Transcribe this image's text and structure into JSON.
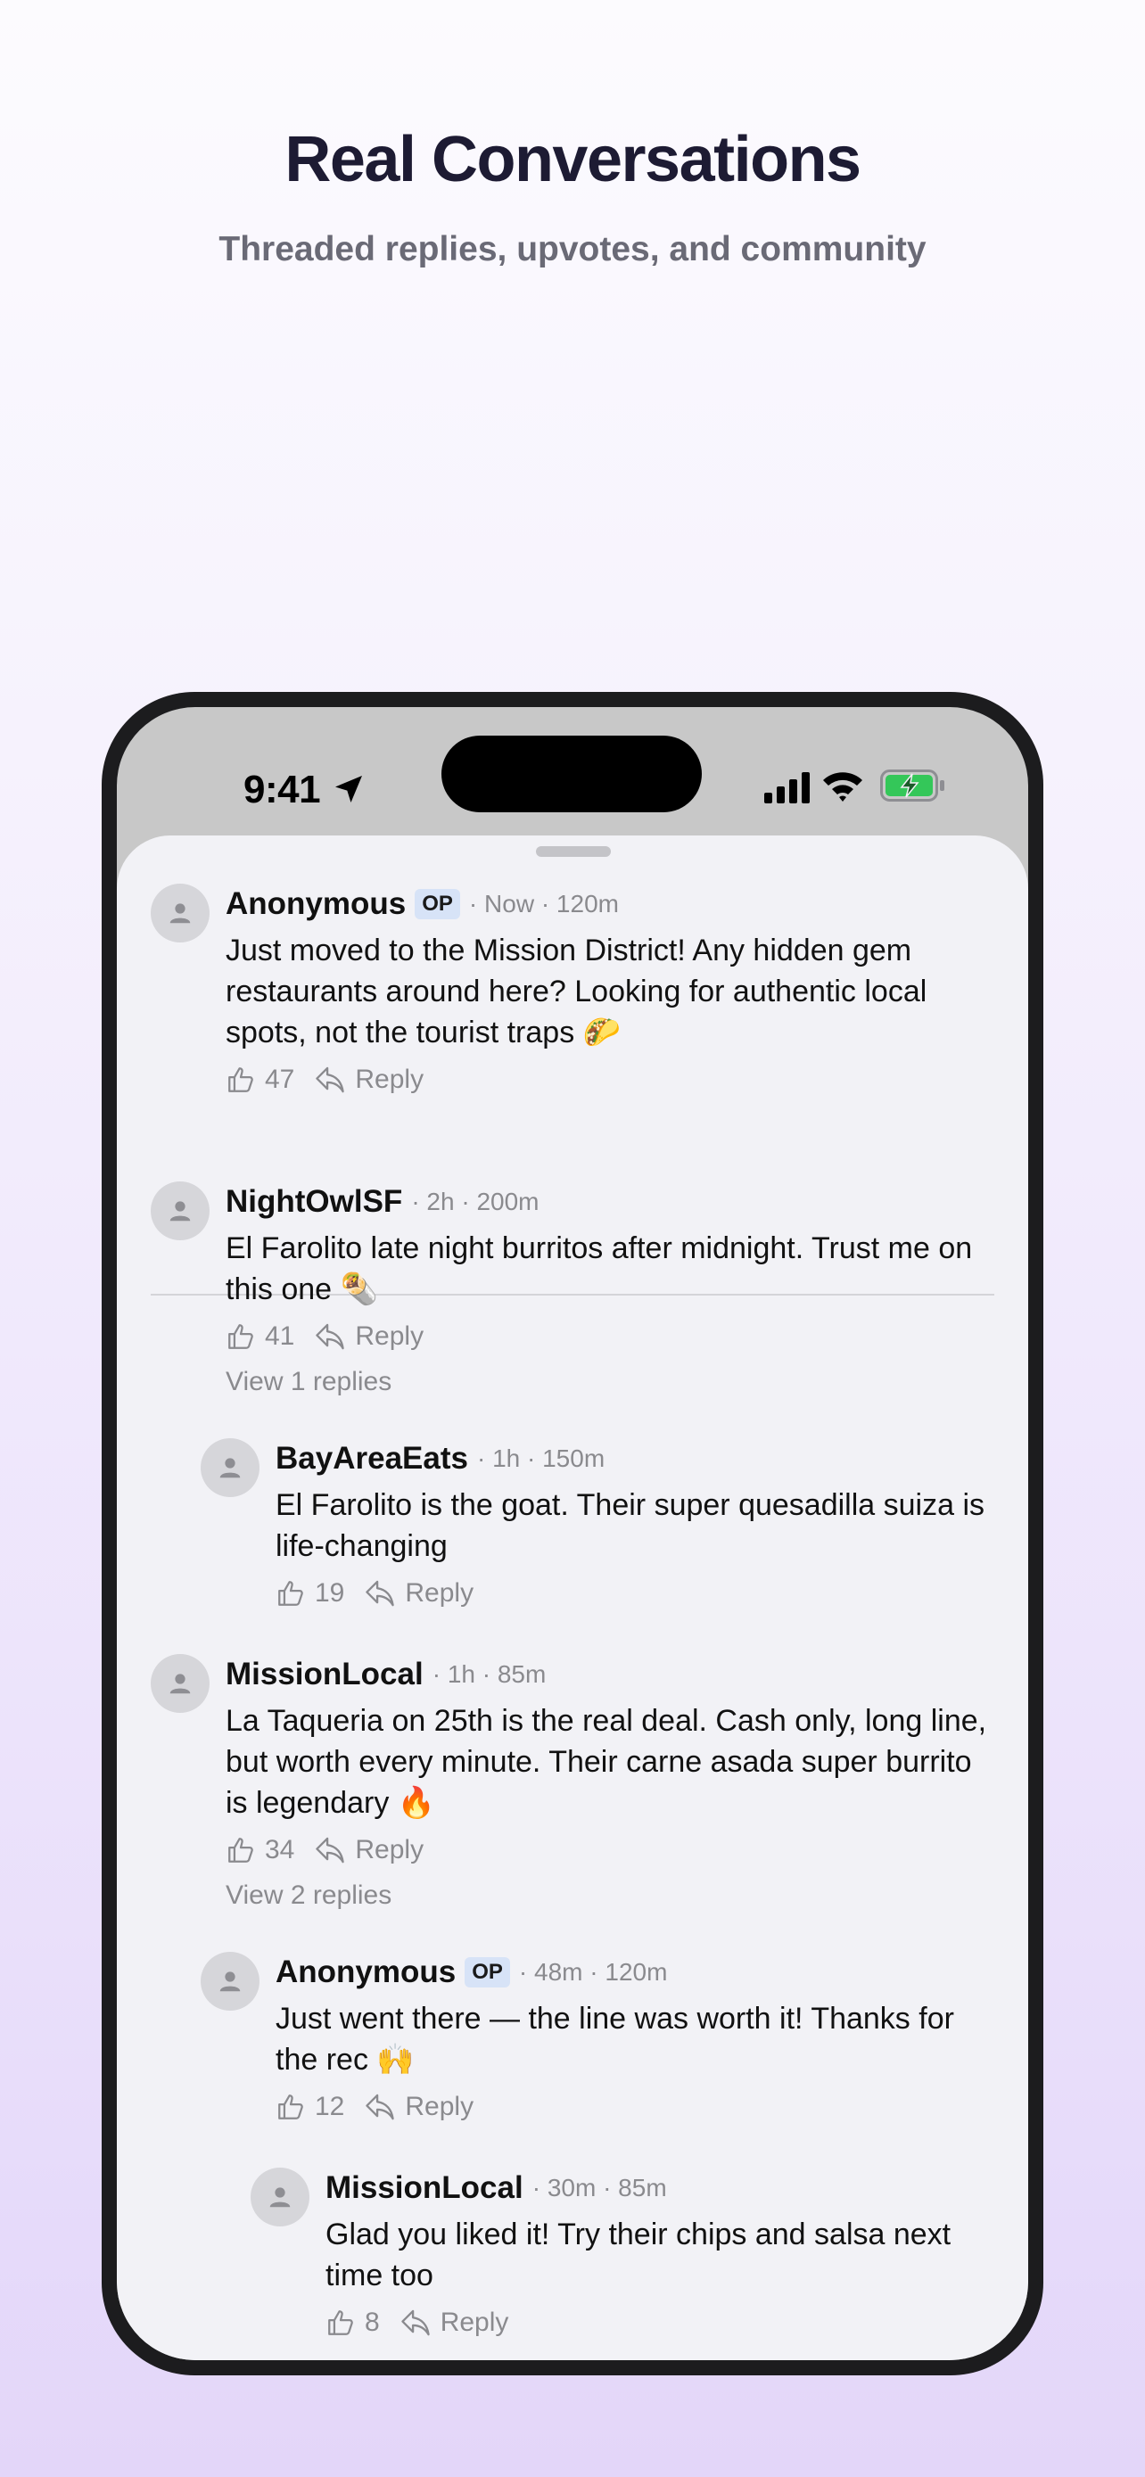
{
  "hero": {
    "title": "Real Conversations",
    "subtitle": "Threaded replies, upvotes, and community"
  },
  "status_bar": {
    "time": "9:41"
  },
  "colors": {
    "background_bottom": "#e3d6f9",
    "op_badge": "#d7e3f7",
    "battery_green": "#34c759"
  },
  "icons": [
    "location-arrow-icon",
    "signal-bars-icon",
    "wifi-icon",
    "battery-charging-icon",
    "person-icon",
    "thumbs-up-icon",
    "reply-arrow-icon"
  ],
  "comments": [
    {
      "author": "Anonymous",
      "op": "OP",
      "meta": "· Now · 120m",
      "text": "Just moved to the Mission District! Any hidden gem restaurants around here? Looking for authentic local spots, not the tourist traps 🌮",
      "upvotes": "47",
      "reply": "Reply"
    },
    {
      "author": "NightOwlSF",
      "meta": "· 2h · 200m",
      "text": "El Farolito late night burritos after midnight. Trust me on this one 🌯",
      "upvotes": "41",
      "reply": "Reply",
      "view_replies": "View 1 replies"
    },
    {
      "author": "BayAreaEats",
      "meta": "· 1h · 150m",
      "text": "El Farolito is the goat. Their super quesadilla suiza is life-changing",
      "upvotes": "19",
      "reply": "Reply"
    },
    {
      "author": "MissionLocal",
      "meta": "· 1h · 85m",
      "text": "La Taqueria on 25th is the real deal. Cash only, long line, but worth every minute. Their carne asada super burrito is legendary 🔥",
      "upvotes": "34",
      "reply": "Reply",
      "view_replies": "View 2 replies"
    },
    {
      "author": "Anonymous",
      "op": "OP",
      "meta": "· 48m · 120m",
      "text": "Just went there — the line was worth it! Thanks for the rec 🙌",
      "upvotes": "12",
      "reply": "Reply"
    },
    {
      "author": "MissionLocal",
      "meta": "· 30m · 85m",
      "text": "Glad you liked it! Try their chips and salsa next time too",
      "upvotes": "8",
      "reply": "Reply"
    }
  ]
}
